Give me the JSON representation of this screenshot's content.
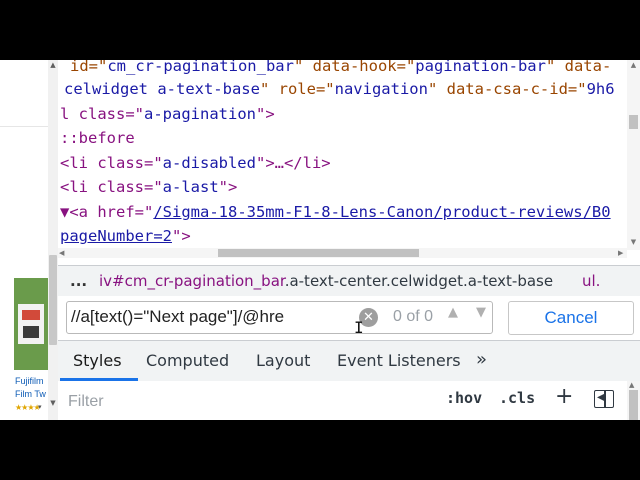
{
  "elements_panel": {
    "lines": [
      {
        "text_a": "id=\"",
        "value": "cm_cr-pagination_bar",
        "text_b": "\" data-hook=\"",
        "value2": "pagination-bar",
        "text_c": "\" data-"
      },
      {
        "text_a": "celwidget a-text-base",
        "text_b": "\" role=\"",
        "value2": "navigation",
        "text_c": "\" data-csa-c-id=\"",
        "value3": "9h6"
      },
      {
        "text_a": "l class=\"",
        "value": "a-pagination",
        "text_b": "\">"
      },
      {
        "text": "::before"
      },
      {
        "text_a": "<li class=\"",
        "value": "a-disabled",
        "text_b": "\">…</li>"
      },
      {
        "text_a": "<li class=\"",
        "value": "a-last",
        "text_b": "\">"
      },
      {
        "text_a": "▼<a href=\"",
        "link": "/Sigma-18-35mm-F1-8-Lens-Canon/product-reviews/B0"
      },
      {
        "link": "pageNumber=2",
        "text_b": "\">"
      }
    ]
  },
  "breadcrumb": {
    "dots": "...",
    "crumb1_prefix": "iv#cm_cr-pagination_bar",
    "crumb1_classes": ".a-text-center.celwidget.a-text-base",
    "crumb2": "ul."
  },
  "search": {
    "value": "//a[text()=\"Next page\"]/@hre",
    "match_count": "0 of 0",
    "cancel_label": "Cancel"
  },
  "tabs": [
    {
      "label": "Styles",
      "active": true
    },
    {
      "label": "Computed",
      "active": false
    },
    {
      "label": "Layout",
      "active": false
    },
    {
      "label": "Event Listeners",
      "active": false
    }
  ],
  "tabs_more": "»",
  "filter": {
    "placeholder": "Filter",
    "hov_label": ":hov",
    "cls_label": ".cls",
    "add_label": "+"
  },
  "page_strip": {
    "product_title_1": "Fujifilm",
    "product_title_2": "Film Tw",
    "stars": "★★★★"
  },
  "colors": {
    "tag": "#881280",
    "attr_name": "#994500",
    "attr_value": "#1a1aa6",
    "accent": "#1a73e8"
  }
}
